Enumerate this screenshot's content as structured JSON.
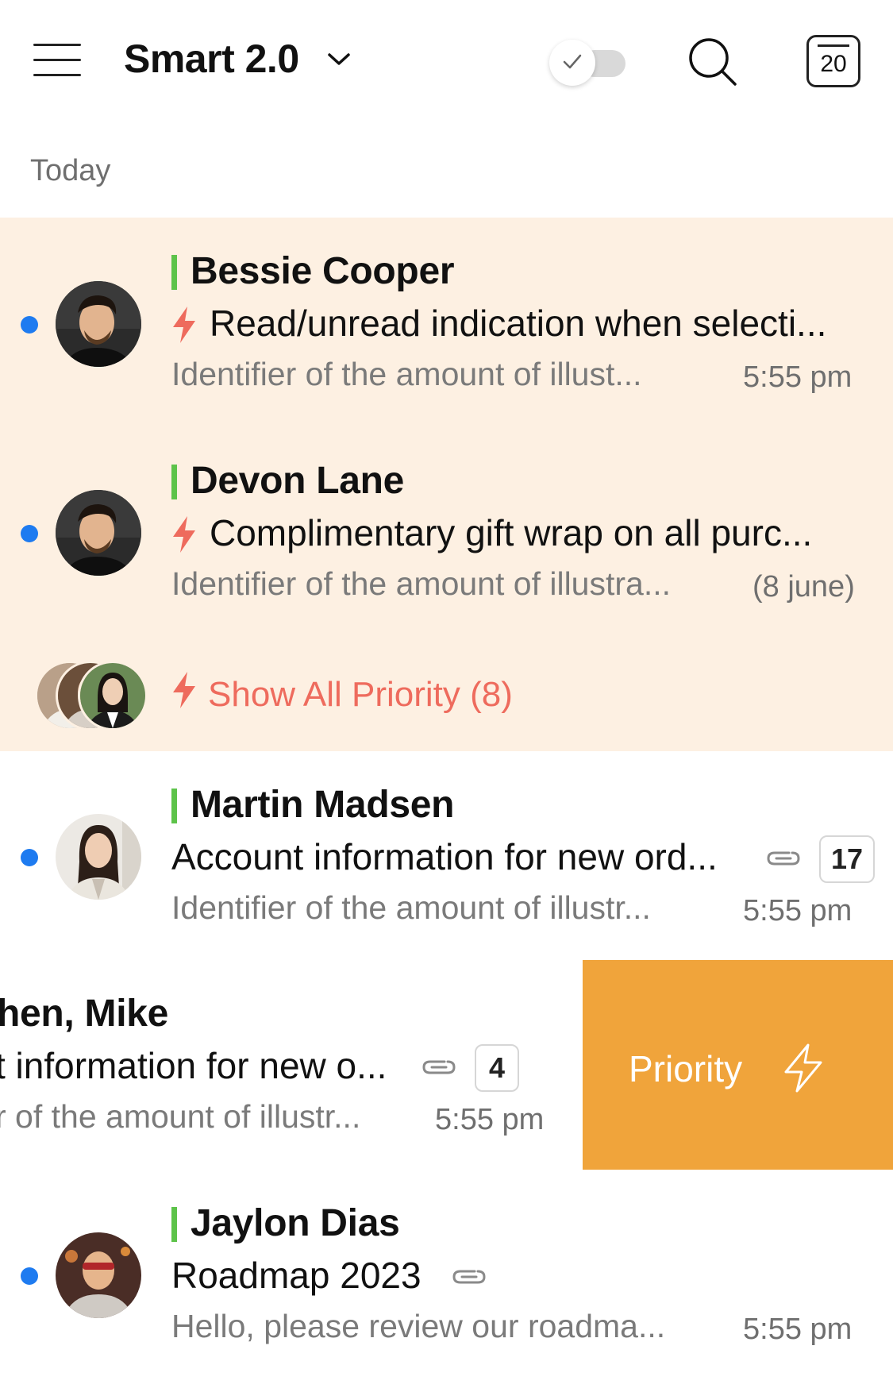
{
  "header": {
    "title": "Smart 2.0",
    "calendar_day": "20"
  },
  "section_label": "Today",
  "priority_emails": [
    {
      "sender": "Bessie Cooper",
      "subject": "Read/unread indication when selecti...",
      "preview": "Identifier of the amount of illust...",
      "time": "5:55 pm"
    },
    {
      "sender": "Devon Lane",
      "subject": "Complimentary gift wrap on all purc...",
      "preview": "Identifier of the amount of illustra...",
      "time": "(8 june)"
    }
  ],
  "show_all_priority": "Show All Priority (8)",
  "emails": [
    {
      "sender": "Martin Madsen",
      "subject": "Account information for new ord...",
      "preview": "Identifier of the amount of illustr...",
      "time": "5:55 pm",
      "count": "17"
    },
    {
      "sender": "hen, Mike",
      "subject": "t information for new o...",
      "preview": "r of the amount of illustr...",
      "time": "5:55 pm",
      "count": "4"
    },
    {
      "sender": "Jaylon Dias",
      "subject": "Roadmap 2023",
      "preview": "Hello, please review our roadma...",
      "time": "5:55 pm"
    }
  ],
  "swipe_action": {
    "label": "Priority"
  },
  "icons": {
    "menu": "hamburger-icon",
    "dropdown": "chevron-down-icon",
    "toggle": "check-icon",
    "search": "search-icon",
    "calendar": "calendar-icon",
    "priority": "lightning-icon",
    "attachment": "paperclip-icon"
  },
  "colors": {
    "priority_bg": "#fdf0e2",
    "unread_dot": "#1e7bf0",
    "sender_mark": "#5dc34a",
    "lightning": "#ee6b5d",
    "swipe_action": "#f0a43b"
  }
}
